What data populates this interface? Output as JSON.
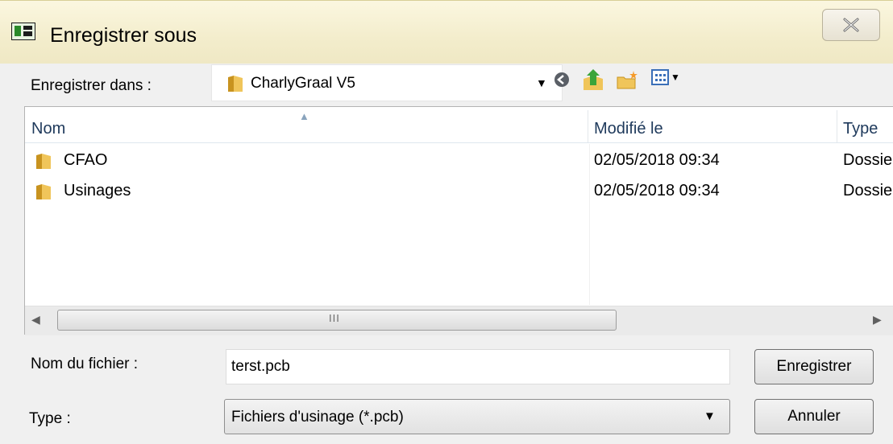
{
  "window": {
    "title": "Enregistrer sous",
    "icons": {
      "app": "app-icon",
      "close": "close-icon"
    }
  },
  "save_in": {
    "label": "Enregistrer dans :",
    "selected": "CharlyGraal V5",
    "icons": [
      "folder-icon",
      "back-icon",
      "up-folder-icon",
      "new-folder-icon",
      "views-menu-icon"
    ]
  },
  "file_list": {
    "columns": [
      "Nom",
      "Modifié le",
      "Type"
    ],
    "sorted_column": "Nom",
    "rows": [
      {
        "name": "CFAO",
        "modified": "02/05/2018 09:34",
        "type": "Dossier de fichiers"
      },
      {
        "name": "Usinages",
        "modified": "02/05/2018 09:34",
        "type": "Dossier de fichiers"
      }
    ]
  },
  "form": {
    "filename_label": "Nom du fichier :",
    "filename_value": "terst.pcb",
    "type_label": "Type :",
    "type_value": "Fichiers d'usinage (*.pcb)"
  },
  "buttons": {
    "save": "Enregistrer",
    "cancel": "Annuler"
  },
  "colors": {
    "titlebar": "#f3edcc",
    "header_text": "#1e395b",
    "folder": "#e8b63c"
  }
}
